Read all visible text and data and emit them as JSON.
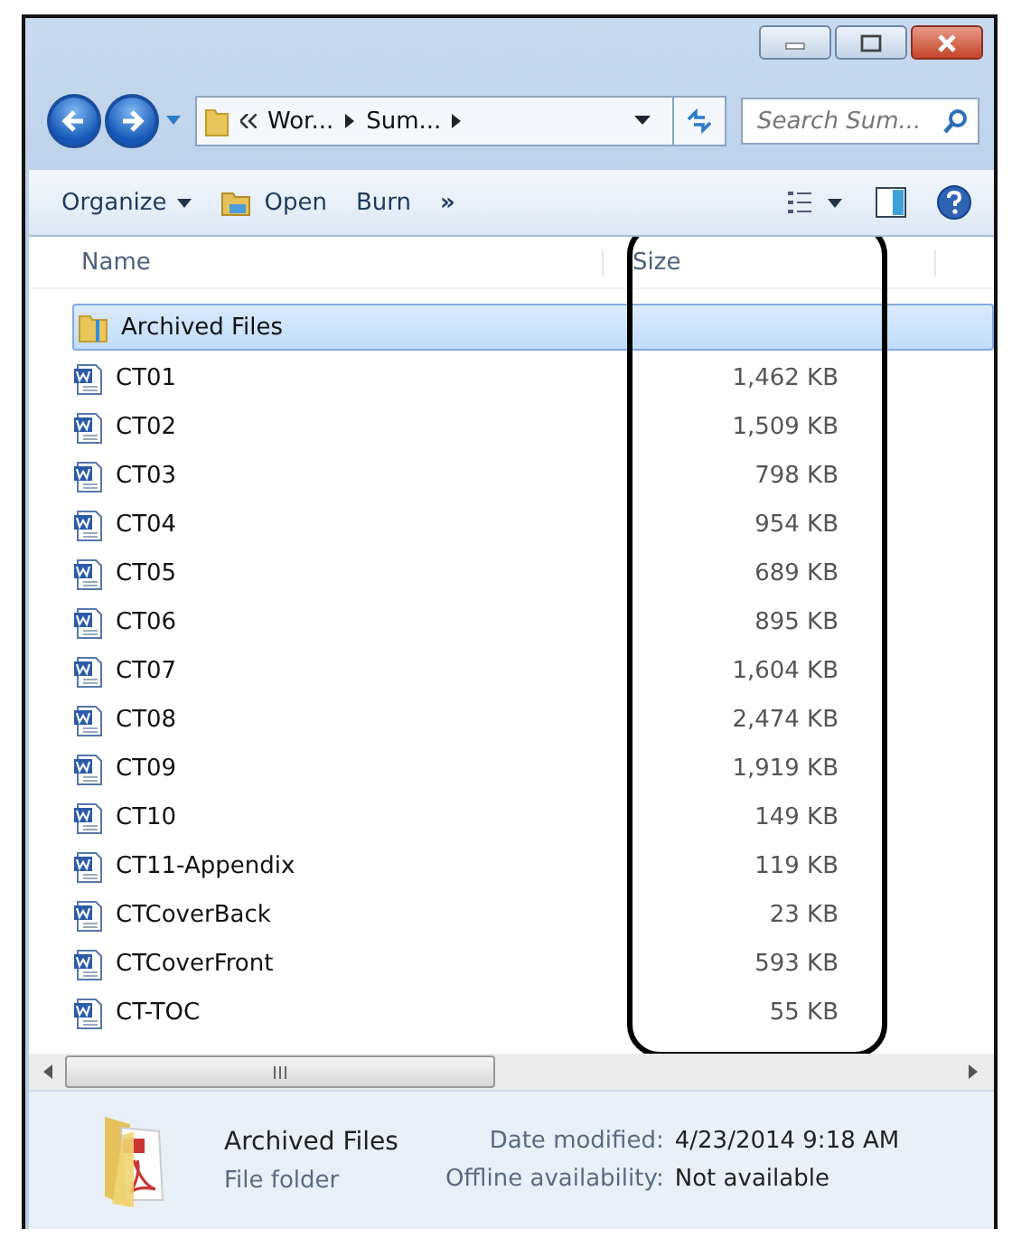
{
  "nav": {
    "path": [
      "Wor...",
      "Sum..."
    ],
    "search": {
      "placeholder": "Search Sum..."
    }
  },
  "toolbar": {
    "items": [
      {
        "kind": "menu",
        "label": "Organize"
      },
      {
        "kind": "open",
        "label": "Open"
      },
      {
        "kind": "plain",
        "label": "Burn"
      },
      {
        "kind": "more",
        "label": "»"
      }
    ]
  },
  "table": {
    "columns": [
      "Name",
      "Size"
    ],
    "rows": [
      {
        "kind": "folder",
        "name": "Archived Files",
        "selected": true
      },
      {
        "kind": "doc",
        "name": "CT01",
        "size": "1,462 KB",
        "selected": false
      },
      {
        "kind": "doc",
        "name": "CT02",
        "size": "1,509 KB",
        "selected": false
      },
      {
        "kind": "doc",
        "name": "CT03",
        "size": "798 KB",
        "selected": false
      },
      {
        "kind": "doc",
        "name": "CT04",
        "size": "954 KB",
        "selected": false
      },
      {
        "kind": "doc",
        "name": "CT05",
        "size": "689 KB",
        "selected": false
      },
      {
        "kind": "doc",
        "name": "CT06",
        "size": "895 KB",
        "selected": false
      },
      {
        "kind": "doc",
        "name": "CT07",
        "size": "1,604 KB",
        "selected": false
      },
      {
        "kind": "doc",
        "name": "CT08",
        "size": "2,474 KB",
        "selected": false
      },
      {
        "kind": "doc",
        "name": "CT09",
        "size": "1,919 KB",
        "selected": false
      },
      {
        "kind": "doc",
        "name": "CT10",
        "size": "149 KB",
        "selected": false
      },
      {
        "kind": "doc",
        "name": "CT11-Appendix",
        "size": "119 KB",
        "selected": false
      },
      {
        "kind": "doc",
        "name": "CTCoverBack",
        "size": "23 KB",
        "selected": false
      },
      {
        "kind": "doc",
        "name": "CTCoverFront",
        "size": "593 KB",
        "selected": false
      },
      {
        "kind": "doc",
        "name": "CT-TOC",
        "size": "55 KB",
        "selected": false
      }
    ]
  },
  "details": {
    "name": "Archived Files",
    "type": "File folder",
    "fields": [
      {
        "label": "Date modified:",
        "value": "4/23/2014 9:18 AM"
      },
      {
        "label": "Offline availability:",
        "value": "Not available"
      }
    ]
  }
}
